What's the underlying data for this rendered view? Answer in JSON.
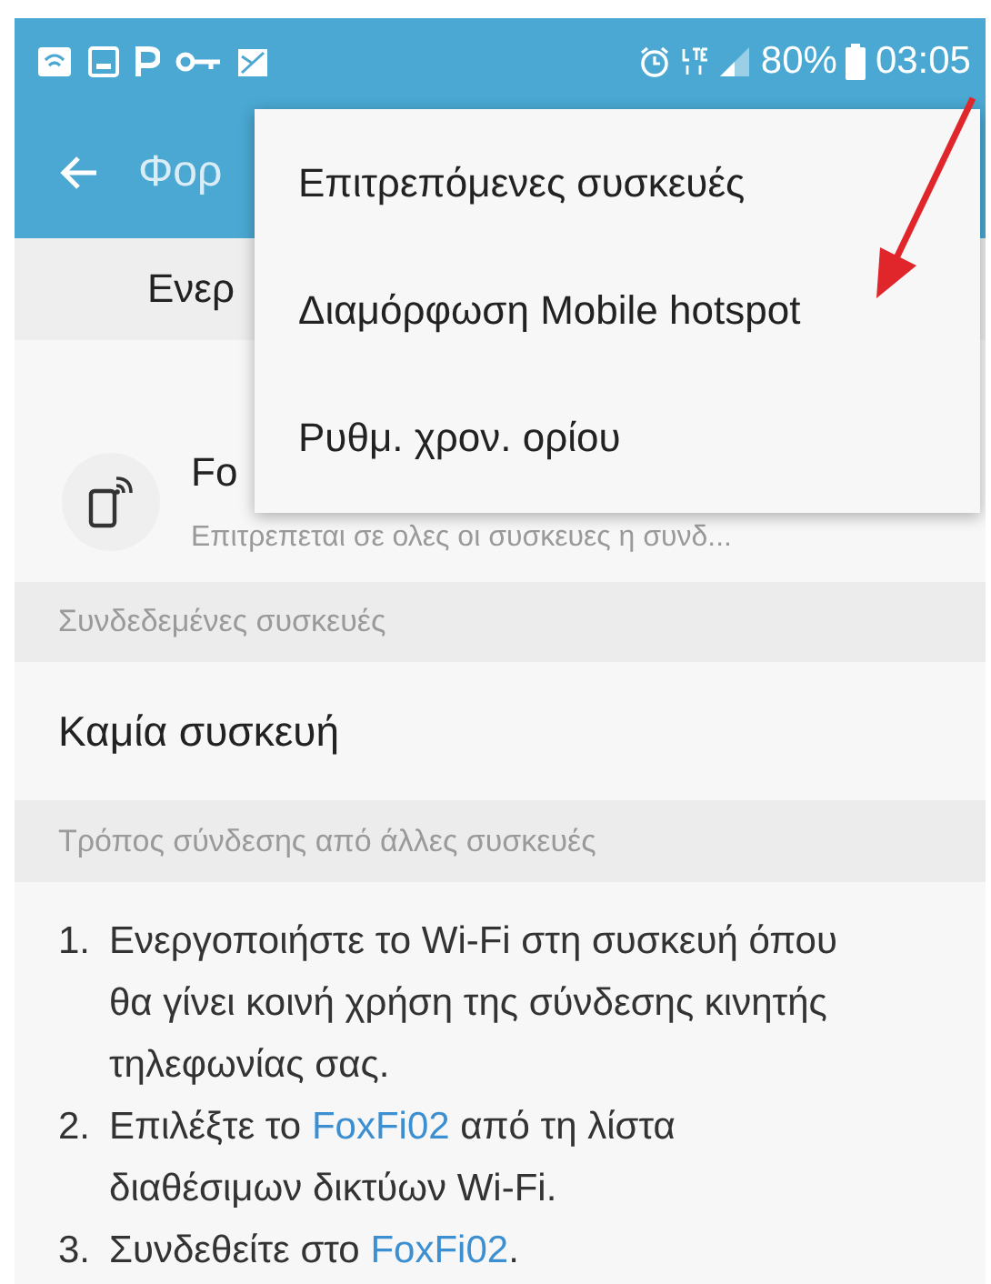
{
  "status_bar": {
    "battery": "80%",
    "time": "03:05"
  },
  "app_bar": {
    "title": "Φορ"
  },
  "toggle_row": {
    "label": "Ενερ"
  },
  "hotspot": {
    "name": "Fo",
    "subtitle": "Επιτρεπεται σε ολες οι συσκευες η συνδ..."
  },
  "connected": {
    "header": "Συνδεδεμένες συσκευές",
    "empty": "Καμία συσκευή"
  },
  "howto": {
    "header": "Τρόπος σύνδεσης από άλλες συσκευές",
    "steps": [
      {
        "number": "1.",
        "parts": [
          {
            "kind": "text",
            "text": "Ενεργοποιήστε το Wi-Fi στη συσκευή όπου θα γίνει κοινή χρήση της σύνδεσης κινητής τηλεφωνίας σας."
          }
        ]
      },
      {
        "number": "2.",
        "parts": [
          {
            "kind": "text",
            "text": "Επιλέξτε το "
          },
          {
            "kind": "link",
            "text": "FoxFi02"
          },
          {
            "kind": "text",
            "text": " από τη λίστα διαθέσιμων δικτύων Wi-Fi."
          }
        ]
      },
      {
        "number": "3.",
        "parts": [
          {
            "kind": "text",
            "text": "Συνδεθείτε στο "
          },
          {
            "kind": "link",
            "text": "FoxFi02"
          },
          {
            "kind": "text",
            "text": "."
          }
        ]
      }
    ]
  },
  "menu": {
    "items": [
      "Επιτρεπόμενες συσκευές",
      "Διαμόρφωση Mobile hotspot",
      "Ρυθμ. χρον. ορίου"
    ]
  }
}
